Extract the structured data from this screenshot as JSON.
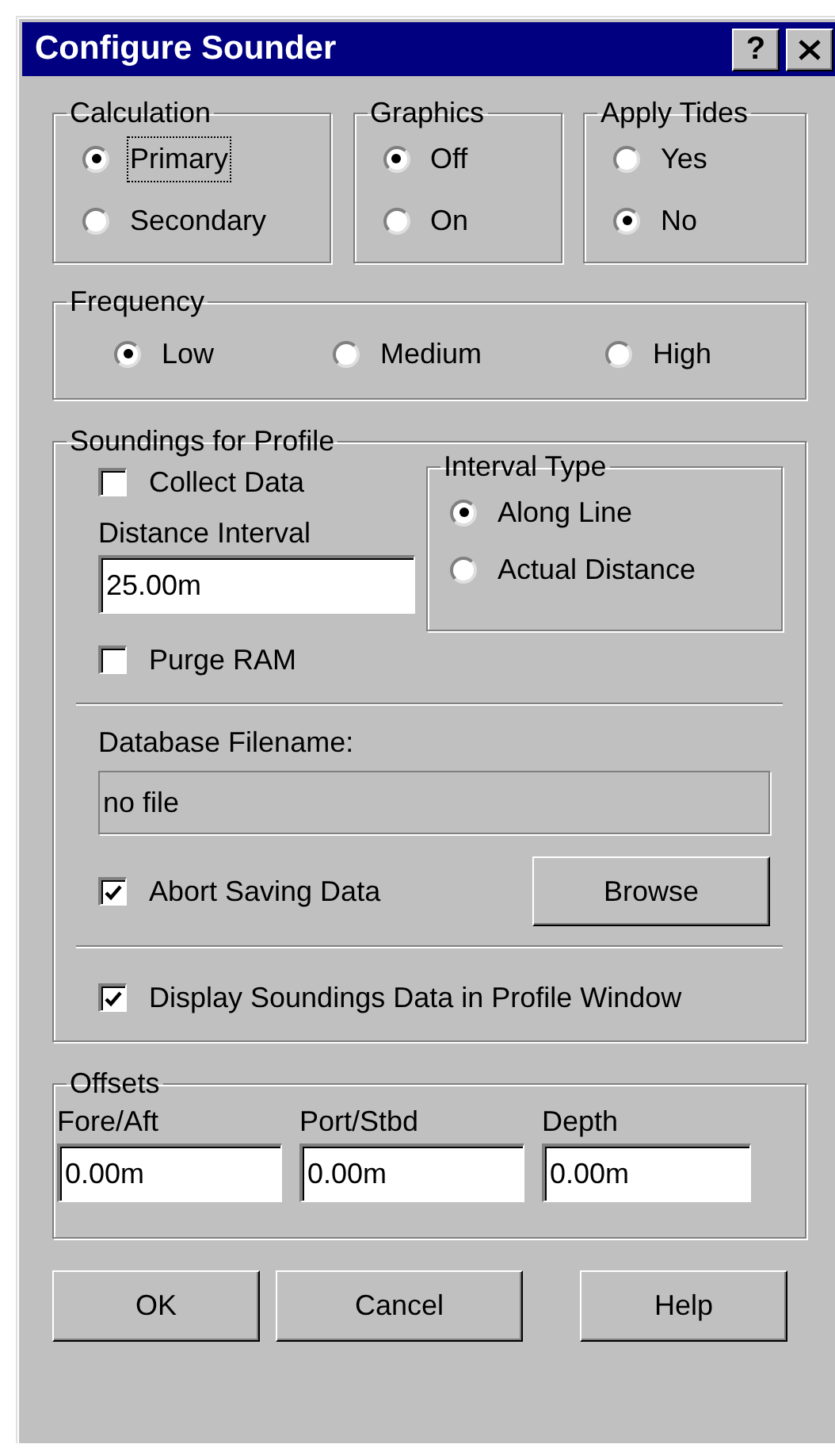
{
  "window": {
    "title": "Configure Sounder",
    "title_buttons": [
      {
        "kind": "help",
        "label": "?"
      },
      {
        "kind": "close"
      }
    ]
  },
  "groups": [
    {
      "title": "Calculation",
      "options": [
        {
          "label": "Primary",
          "selected": true,
          "focused": true
        },
        {
          "label": "Secondary",
          "selected": false,
          "focused": false
        }
      ]
    },
    {
      "title": "Graphics",
      "options": [
        {
          "label": "Off",
          "selected": true,
          "focused": false
        },
        {
          "label": "On",
          "selected": false,
          "focused": false
        }
      ]
    },
    {
      "title": "Apply Tides",
      "options": [
        {
          "label": "Yes",
          "selected": false,
          "focused": false
        },
        {
          "label": "No",
          "selected": true,
          "focused": false
        }
      ]
    }
  ],
  "frequency": {
    "title": "Frequency",
    "options": [
      {
        "label": "Low",
        "selected": true,
        "focused": false
      },
      {
        "label": "Medium",
        "selected": false,
        "focused": false
      },
      {
        "label": "High",
        "selected": false,
        "focused": false
      }
    ]
  },
  "soundings": {
    "title": "Soundings for Profile",
    "collect_data": {
      "label": "Collect Data",
      "checked": false
    },
    "distance_interval": {
      "label": "Distance Interval",
      "value": "25.00m"
    },
    "purge_ram": {
      "label": "Purge RAM",
      "checked": false
    },
    "interval_type": {
      "title": "Interval Type",
      "options": [
        {
          "label": "Along Line",
          "selected": true,
          "focused": false
        },
        {
          "label": "Actual Distance",
          "selected": false,
          "focused": false
        }
      ]
    },
    "database_filename": {
      "label": "Database Filename:",
      "value": "no file"
    },
    "abort_saving": {
      "label": "Abort Saving Data",
      "checked": true
    },
    "browse_button": "Browse",
    "display_data": {
      "label": "Display Soundings Data in Profile Window",
      "checked": true
    }
  },
  "offsets": {
    "title": "Offsets",
    "fields": [
      {
        "label": "Fore/Aft",
        "value": "0.00m"
      },
      {
        "label": "Port/Stbd",
        "value": "0.00m"
      },
      {
        "label": "Depth",
        "value": "0.00m"
      }
    ]
  },
  "buttons": [
    "OK",
    "Cancel",
    "Help"
  ]
}
